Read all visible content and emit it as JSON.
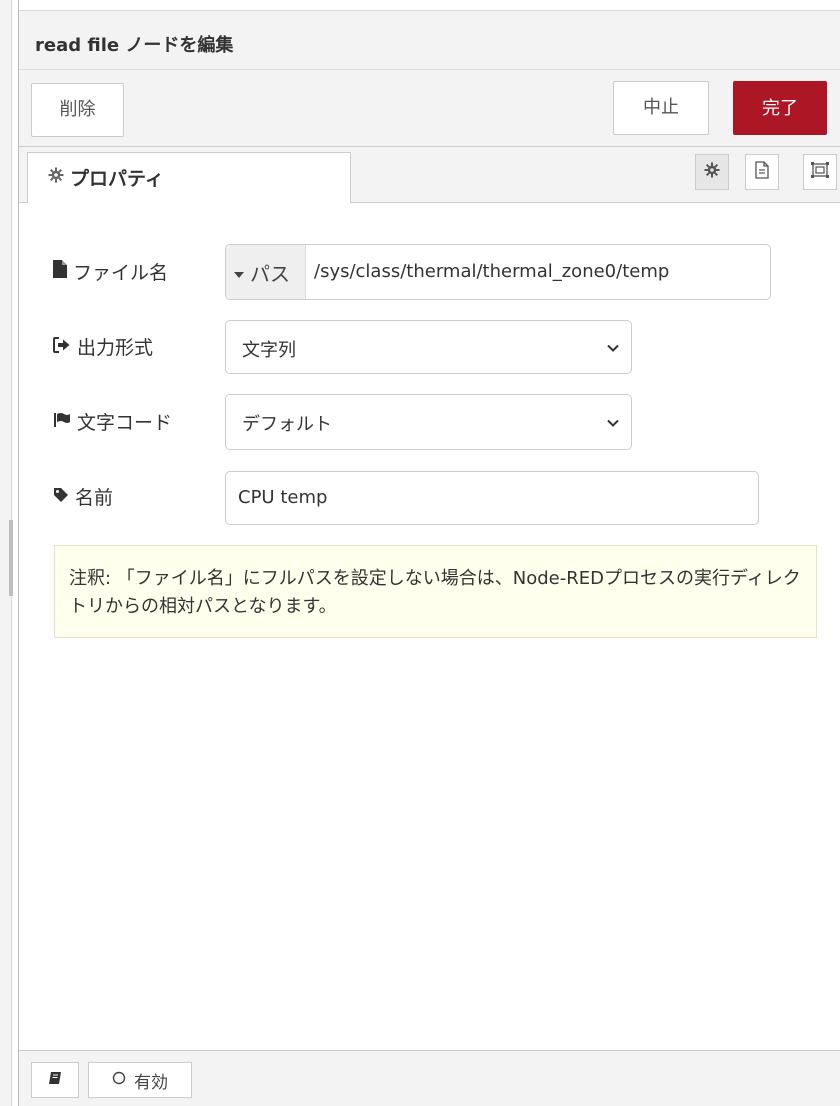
{
  "dialog": {
    "title": "read file ノードを編集"
  },
  "buttons": {
    "delete": "削除",
    "cancel": "中止",
    "done": "完了"
  },
  "tabs": [
    {
      "label": "プロパティ",
      "icon": "gear-icon",
      "active": true
    }
  ],
  "tab_tools": [
    {
      "icon": "gear-icon",
      "active": true
    },
    {
      "icon": "description-icon",
      "active": false
    },
    {
      "icon": "appearance-icon",
      "active": false
    }
  ],
  "form": {
    "filename": {
      "label": "ファイル名",
      "icon": "file-icon",
      "type_label": "パス",
      "value": "/sys/class/thermal/thermal_zone0/temp"
    },
    "output": {
      "label": "出力形式",
      "icon": "sign-out-icon",
      "value": "文字列"
    },
    "encoding": {
      "label": "文字コード",
      "icon": "flag-icon",
      "value": "デフォルト"
    },
    "name": {
      "label": "名前",
      "icon": "tag-icon",
      "value": "CPU temp"
    }
  },
  "tip": {
    "text": "注釈: 「ファイル名」にフルパスを設定しない場合は、Node-REDプロセスの実行ディレクトリからの相対パスとなります。"
  },
  "footer": {
    "toggle_label": "有効"
  },
  "colors": {
    "done_button": "#ad1625",
    "tip_background": "#ffffed",
    "chrome_background": "#f3f3f3"
  }
}
